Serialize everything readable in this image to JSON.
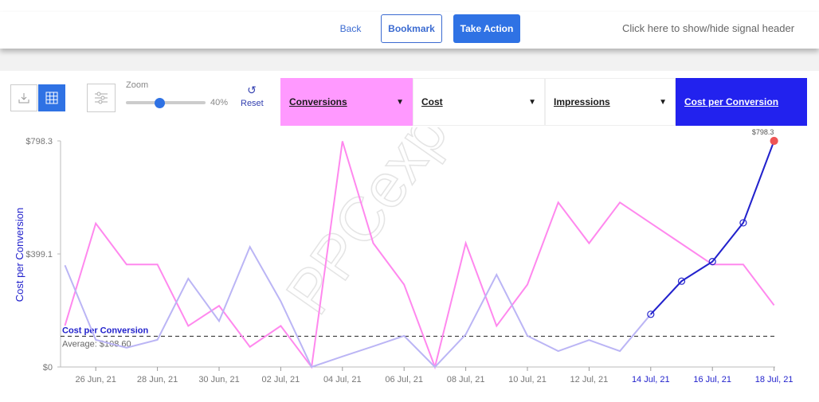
{
  "topbar": {
    "back": "Back",
    "bookmark": "Bookmark",
    "take_action": "Take Action",
    "signal_toggle": "Click here to show/hide signal header"
  },
  "toolbar": {
    "zoom_label": "Zoom",
    "zoom_value": 40,
    "zoom_pct": "40%",
    "reset": "Reset",
    "download_icon": "download-icon",
    "table_icon": "grid-icon",
    "filter_icon": "sliders-icon",
    "reset_icon": "undo-icon"
  },
  "metrics": [
    {
      "label": "Conversions",
      "color": "#ff99ff",
      "text_color": "#1a1a1a",
      "dropdown": true
    },
    {
      "label": "Cost",
      "color": "#ffffff",
      "text_color": "#1a1a1a",
      "dropdown": true
    },
    {
      "label": "Impressions",
      "color": "#ffffff",
      "text_color": "#1a1a1a",
      "dropdown": true
    },
    {
      "label": "Cost per Conversion",
      "color": "#2222ee",
      "text_color": "#ffffff",
      "dropdown": false
    }
  ],
  "watermark": "PPCexpo",
  "chart_data": {
    "type": "line",
    "ylabel": "Cost per Conversion",
    "ylim": [
      0,
      798.3
    ],
    "yticks": [
      "$0",
      "$399.1",
      "$798.3"
    ],
    "x": [
      "25 Jun",
      "26 Jun",
      "27 Jun",
      "28 Jun",
      "29 Jun",
      "30 Jun",
      "01 Jul",
      "02 Jul",
      "03 Jul",
      "04 Jul",
      "05 Jul",
      "06 Jul",
      "07 Jul",
      "08 Jul",
      "09 Jul",
      "10 Jul",
      "11 Jul",
      "12 Jul",
      "13 Jul",
      "14 Jul",
      "15 Jul",
      "16 Jul",
      "17 Jul",
      "18 Jul"
    ],
    "xtick_labels": [
      "26 Jun, 21",
      "28 Jun, 21",
      "30 Jun, 21",
      "02 Jul, 21",
      "04 Jul, 21",
      "06 Jul, 21",
      "08 Jul, 21",
      "10 Jul, 21",
      "12 Jul, 21",
      "14 Jul, 21",
      "16 Jul, 21",
      "18 Jul, 21"
    ],
    "highlighted_ticks": [
      "14 Jul, 21",
      "16 Jul, 21",
      "18 Jul, 21"
    ],
    "series": [
      {
        "name": "Conversions",
        "color": "#ff88ee",
        "values": [
          146,
          507,
          362,
          362,
          145,
          216,
          71,
          145,
          0,
          797,
          437,
          291,
          0,
          437,
          145,
          291,
          581,
          437,
          581,
          508,
          435,
          362,
          362,
          218
        ]
      },
      {
        "name": "Cost per Conversion",
        "color": "#bbb5f5",
        "highlight_color": "#2222cc",
        "highlight_from": "14 Jul",
        "values": [
          359,
          96,
          68,
          96,
          312,
          162,
          424,
          232,
          0,
          37,
          73,
          110,
          0,
          115,
          326,
          110,
          56,
          95,
          56,
          186,
          303,
          372,
          509,
          798.3
        ]
      }
    ],
    "average": {
      "label": "Cost per Conversion",
      "text": "Average: $108.60",
      "value": 108.6
    },
    "max_label": "$798.3",
    "grid": false
  }
}
